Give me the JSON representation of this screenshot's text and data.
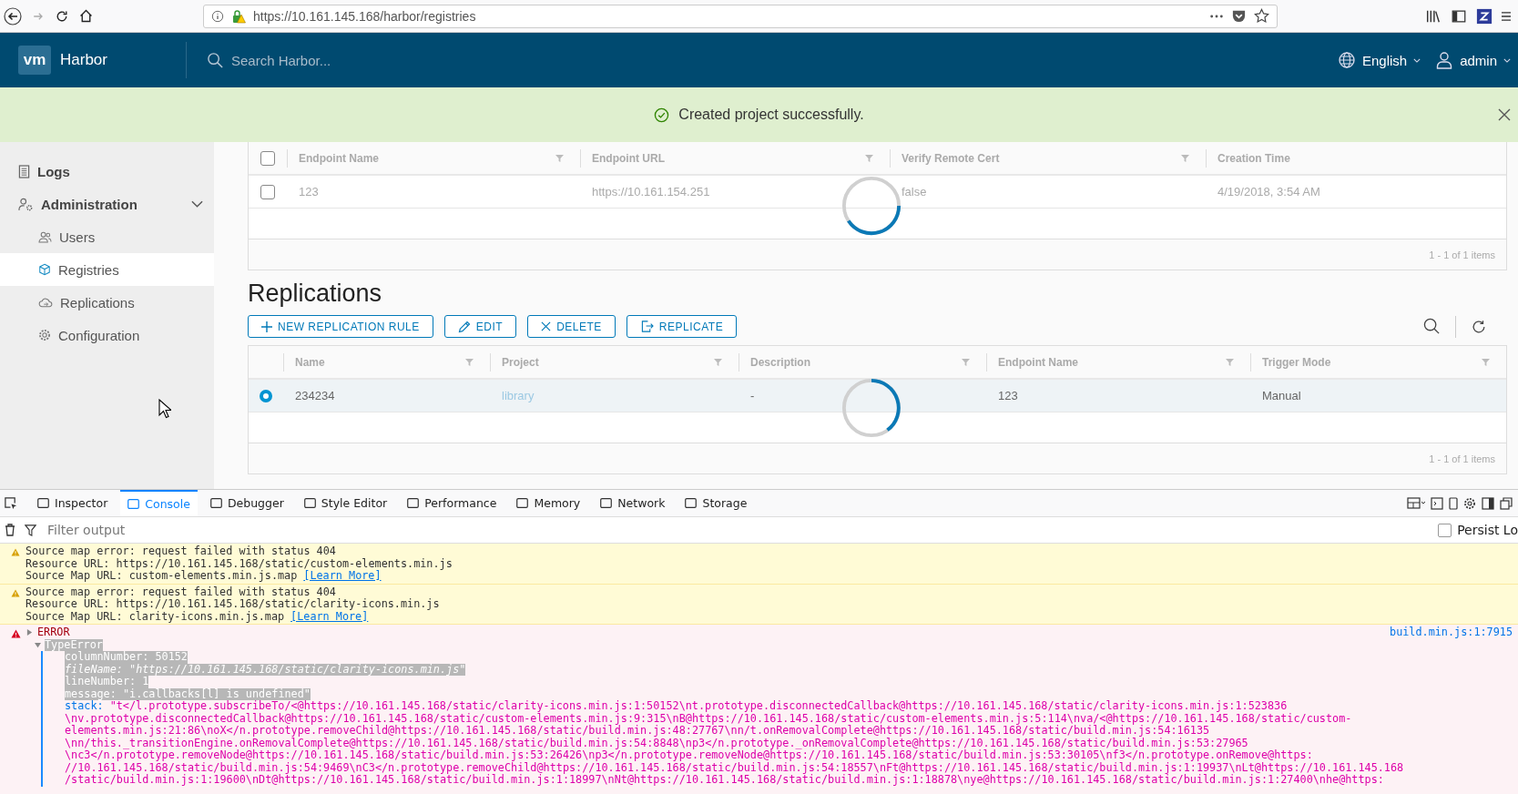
{
  "browser": {
    "url": "https://10.161.145.168/harbor/registries"
  },
  "header": {
    "logo": "vm",
    "title": "Harbor",
    "search": {
      "placeholder": "Search Harbor..."
    },
    "language": "English",
    "user": "admin"
  },
  "alert": {
    "message": "Created project successfully."
  },
  "sidebar": {
    "items": [
      {
        "label": "Logs",
        "kind": "top",
        "selected": false
      },
      {
        "label": "Administration",
        "kind": "group",
        "expanded": true,
        "selected": false,
        "children": [
          {
            "label": "Users",
            "selected": false
          },
          {
            "label": "Registries",
            "selected": true
          },
          {
            "label": "Replications",
            "selected": false
          },
          {
            "label": "Configuration",
            "selected": false
          }
        ]
      }
    ]
  },
  "endpoints": {
    "all_selected": false,
    "columns": [
      "Endpoint Name",
      "Endpoint URL",
      "Verify Remote Cert",
      "Creation Time"
    ],
    "rows": [
      {
        "selected": false,
        "cells": [
          "123",
          "https://10.161.154.251",
          "false",
          "4/19/2018, 3:54 AM"
        ]
      }
    ],
    "footer": "1 - 1 of 1 items"
  },
  "replications": {
    "title": "Replications",
    "buttons": [
      {
        "label": "NEW REPLICATION RULE",
        "kind": "add"
      },
      {
        "label": "EDIT",
        "kind": "edit"
      },
      {
        "label": "DELETE",
        "kind": "delete"
      },
      {
        "label": "REPLICATE",
        "kind": "replicate"
      }
    ],
    "columns": [
      "Name",
      "Project",
      "Description",
      "Endpoint Name",
      "Trigger Mode"
    ],
    "rows": [
      {
        "selected": true,
        "cells": [
          "234234",
          "library",
          "-",
          "123",
          "Manual"
        ]
      }
    ],
    "footer": "1 - 1 of 1 items"
  },
  "devtools": {
    "tabs": [
      {
        "label": "Inspector",
        "selected": false
      },
      {
        "label": "Console",
        "selected": true
      },
      {
        "label": "Debugger",
        "selected": false
      },
      {
        "label": "Style Editor",
        "selected": false
      },
      {
        "label": "Performance",
        "selected": false
      },
      {
        "label": "Memory",
        "selected": false
      },
      {
        "label": "Network",
        "selected": false
      },
      {
        "label": "Storage",
        "selected": false
      }
    ],
    "filter": {
      "placeholder": "Filter output"
    },
    "persist": {
      "label": "Persist Lo",
      "checked": false
    },
    "messages": [
      {
        "kind": "warning",
        "lines": [
          "Source map error: request failed with status 404",
          "Resource URL: https://10.161.145.168/static/custom-elements.min.js",
          "Source Map URL: custom-elements.min.js.map"
        ],
        "link": "[Learn More]"
      },
      {
        "kind": "warning",
        "lines": [
          "Source map error: request failed with status 404",
          "Resource URL: https://10.161.145.168/static/clarity-icons.min.js",
          "Source Map URL: clarity-icons.min.js.map"
        ],
        "link": "[Learn More]"
      },
      {
        "kind": "error",
        "title": "ERROR",
        "source": "build.min.js:1:7915",
        "expanded": true,
        "exception": "TypeError",
        "props": [
          "columnNumber: 50152",
          "fileName: \"https://10.161.145.168/static/clarity-icons.min.js\"",
          "lineNumber: 1",
          "message: \"i.callbacks[l] is undefined\""
        ],
        "stack_key": "stack:",
        "stack_lines": [
          "\"t</l.prototype.subscribeTo/<@https://10.161.145.168/static/clarity-icons.min.js:1:50152\\nt.prototype.disconnectedCallback@https://10.161.145.168/static/clarity-icons.min.js:1:523836",
          "\\nv.prototype.disconnectedCallback@https://10.161.145.168/static/custom-elements.min.js:9:315\\nB@https://10.161.145.168/static/custom-elements.min.js:5:114\\nva/<@https://10.161.145.168/static/custom-",
          "elements.min.js:21:86\\noX</n.prototype.removeChild@https://10.161.145.168/static/build.min.js:48:27767\\nn/t.onRemovalComplete@https://10.161.145.168/static/build.min.js:54:16135",
          "\\nn/this._transitionEngine.onRemovalComplete@https://10.161.145.168/static/build.min.js:54:8848\\np3</n.prototype._onRemovalComplete@https://10.161.145.168/static/build.min.js:53:27965",
          "\\nc3</n.prototype.removeNode@https://10.161.145.168/static/build.min.js:53:26426\\np3</n.prototype.removeNode@https://10.161.145.168/static/build.min.js:53:30105\\nf3</n.prototype.onRemove@https:",
          "//10.161.145.168/static/build.min.js:54:9469\\nC3</n.prototype.removeChild@https://10.161.145.168/static/build.min.js:54:18557\\nFt@https://10.161.145.168/static/build.min.js:1:19937\\nLt@https://10.161.145.168",
          "/static/build.min.js:1:19600\\nDt@https://10.161.145.168/static/build.min.js:1:18997\\nNt@https://10.161.145.168/static/build.min.js:1:18878\\nye@https://10.161.145.168/static/build.min.js:1:27400\\nhe@https:"
        ]
      }
    ]
  }
}
